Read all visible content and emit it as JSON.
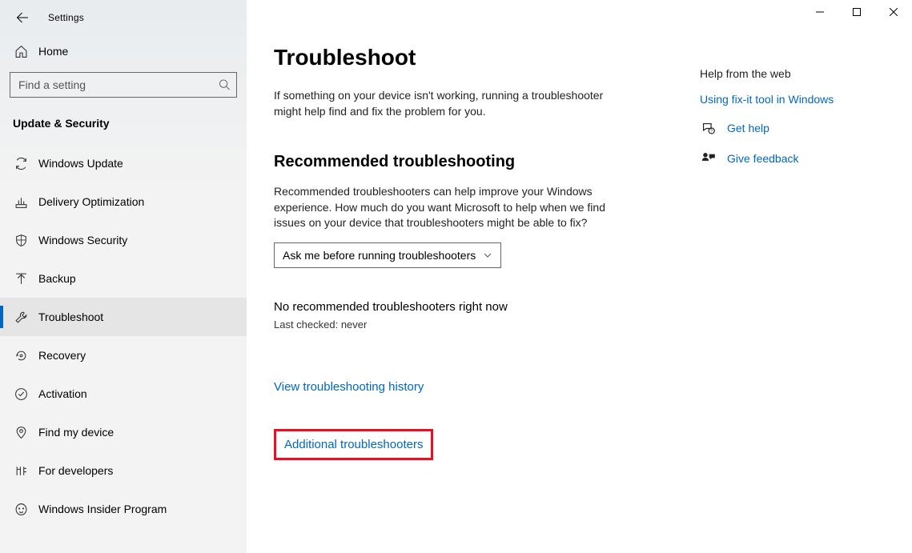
{
  "window": {
    "title": "Settings"
  },
  "sidebar": {
    "home_label": "Home",
    "search_placeholder": "Find a setting",
    "category": "Update & Security",
    "items": [
      {
        "label": "Windows Update"
      },
      {
        "label": "Delivery Optimization"
      },
      {
        "label": "Windows Security"
      },
      {
        "label": "Backup"
      },
      {
        "label": "Troubleshoot",
        "selected": true
      },
      {
        "label": "Recovery"
      },
      {
        "label": "Activation"
      },
      {
        "label": "Find my device"
      },
      {
        "label": "For developers"
      },
      {
        "label": "Windows Insider Program"
      }
    ]
  },
  "main": {
    "title": "Troubleshoot",
    "description": "If something on your device isn't working, running a troubleshooter might help find and fix the problem for you.",
    "recommended": {
      "heading": "Recommended troubleshooting",
      "description": "Recommended troubleshooters can help improve your Windows experience. How much do you want Microsoft to help when we find issues on your device that troubleshooters might be able to fix?",
      "dropdown_value": "Ask me before running troubleshooters",
      "status": "No recommended troubleshooters right now",
      "status_sub": "Last checked: never"
    },
    "links": {
      "history": "View troubleshooting history",
      "additional": "Additional troubleshooters"
    }
  },
  "aside": {
    "heading": "Help from the web",
    "link": "Using fix-it tool in Windows",
    "help": "Get help",
    "feedback": "Give feedback"
  }
}
